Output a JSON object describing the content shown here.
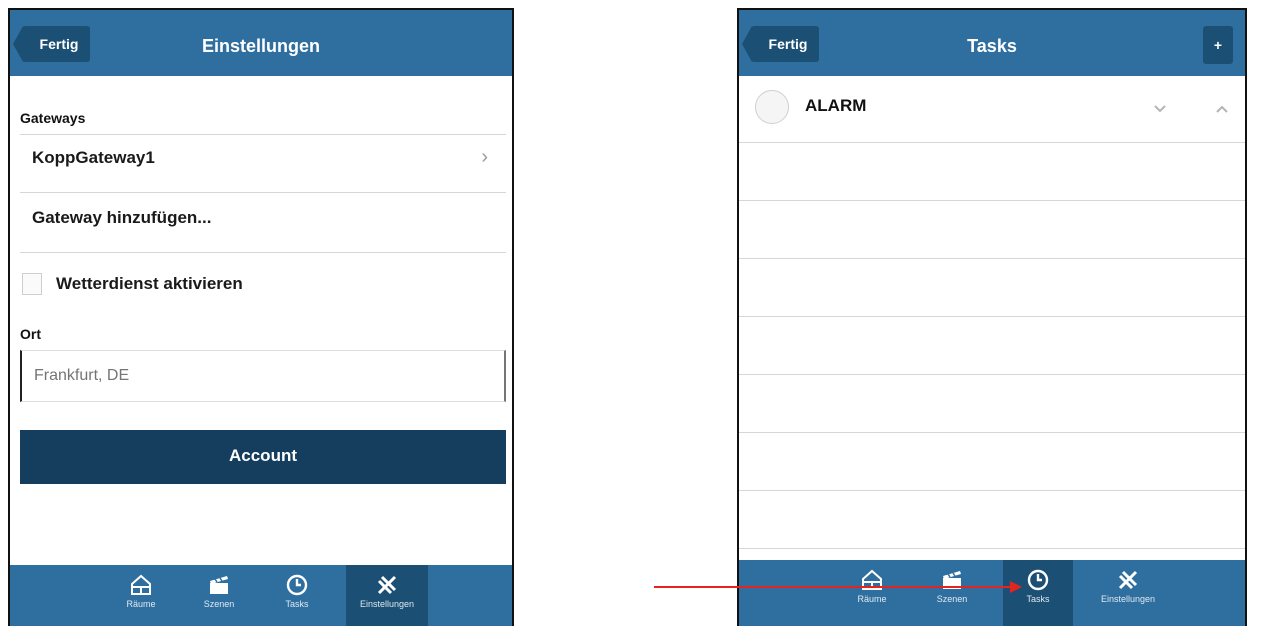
{
  "left_screen": {
    "header": {
      "back_label": "Fertig",
      "title": "Einstellungen"
    },
    "gateways_label": "Gateways",
    "gateway_items": [
      {
        "label": "KoppGateway1"
      }
    ],
    "add_gateway_label": "Gateway hinzufügen...",
    "weather_checkbox": {
      "label": "Wetterdienst aktivieren",
      "checked": false
    },
    "location_label": "Ort",
    "location_placeholder": "Frankfurt, DE",
    "account_button": "Account"
  },
  "right_screen": {
    "header": {
      "back_label": "Fertig",
      "title": "Tasks",
      "add_label": "+"
    },
    "tasks": [
      {
        "name": "ALARM",
        "expand_icon": "chevron-down-icon",
        "collapse_icon": "chevron-up-icon"
      }
    ]
  },
  "tabbar": {
    "tabs": [
      {
        "label": "Räume",
        "icon": "house-icon"
      },
      {
        "label": "Szenen",
        "icon": "clapperboard-icon"
      },
      {
        "label": "Tasks",
        "icon": "clock-icon"
      },
      {
        "label": "Einstellungen",
        "icon": "wrench-icon"
      }
    ]
  },
  "colors": {
    "bar": "#2f6f9f",
    "bar_active": "#1c4f74",
    "account": "#143d5e",
    "annotation_arrow": "#e52420"
  }
}
